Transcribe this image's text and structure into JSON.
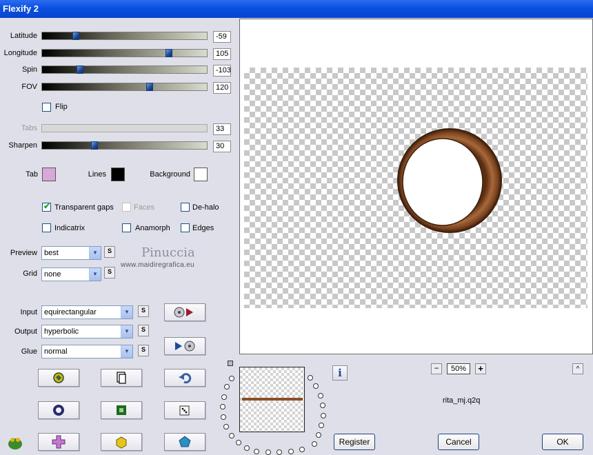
{
  "window": {
    "title": "Flexify 2"
  },
  "sliders": [
    {
      "id": "latitude",
      "label": "Latitude",
      "value": "-59",
      "position": 0.19,
      "disabled": false
    },
    {
      "id": "longitude",
      "label": "Longitude",
      "value": "105",
      "position": 0.78,
      "disabled": false
    },
    {
      "id": "spin",
      "label": "Spin",
      "value": "-103",
      "position": 0.22,
      "disabled": false
    },
    {
      "id": "fov",
      "label": "FOV",
      "value": "120",
      "position": 0.66,
      "disabled": false
    },
    {
      "id": "tabs",
      "label": "Tabs",
      "value": "33",
      "position": null,
      "disabled": true
    },
    {
      "id": "sharpen",
      "label": "Sharpen",
      "value": "30",
      "position": 0.31,
      "disabled": false
    }
  ],
  "flip": {
    "label": "Flip",
    "checked": false
  },
  "colors": {
    "tab_label": "Tab",
    "tab_color": "#d9a8d9",
    "lines_label": "Lines",
    "lines_color": "#000000",
    "background_label": "Background",
    "background_color": "#ffffff"
  },
  "checkboxes": {
    "transparent_gaps": {
      "label": "Transparent gaps",
      "checked": true
    },
    "faces": {
      "label": "Faces",
      "checked": false,
      "disabled": true
    },
    "de_halo": {
      "label": "De-halo",
      "checked": false
    },
    "indicatrix": {
      "label": "Indicatrix",
      "checked": false
    },
    "anamorph": {
      "label": "Anamorph",
      "checked": false
    },
    "edges": {
      "label": "Edges",
      "checked": false
    }
  },
  "selects": {
    "preview": {
      "label": "Preview",
      "value": "best"
    },
    "grid": {
      "label": "Grid",
      "value": "none"
    },
    "input": {
      "label": "Input",
      "value": "equirectangular"
    },
    "output": {
      "label": "Output",
      "value": "hyperbolic"
    },
    "glue": {
      "label": "Glue",
      "value": "normal"
    }
  },
  "s_button_label": "S",
  "watermark": {
    "name": "Pinuccia",
    "url": "www.maidiregrafica.eu"
  },
  "zoom": {
    "minus": "−",
    "value": "50%",
    "plus": "+"
  },
  "filename": "rita_mj.q2q",
  "info_label": "i",
  "collapse_label": "^",
  "buttons": {
    "register": "Register",
    "cancel": "Cancel",
    "ok": "OK"
  },
  "colors_ui": {
    "accent": "#0a4fe0",
    "ring": "#8a4f25",
    "panel": "#dfdfe9"
  }
}
